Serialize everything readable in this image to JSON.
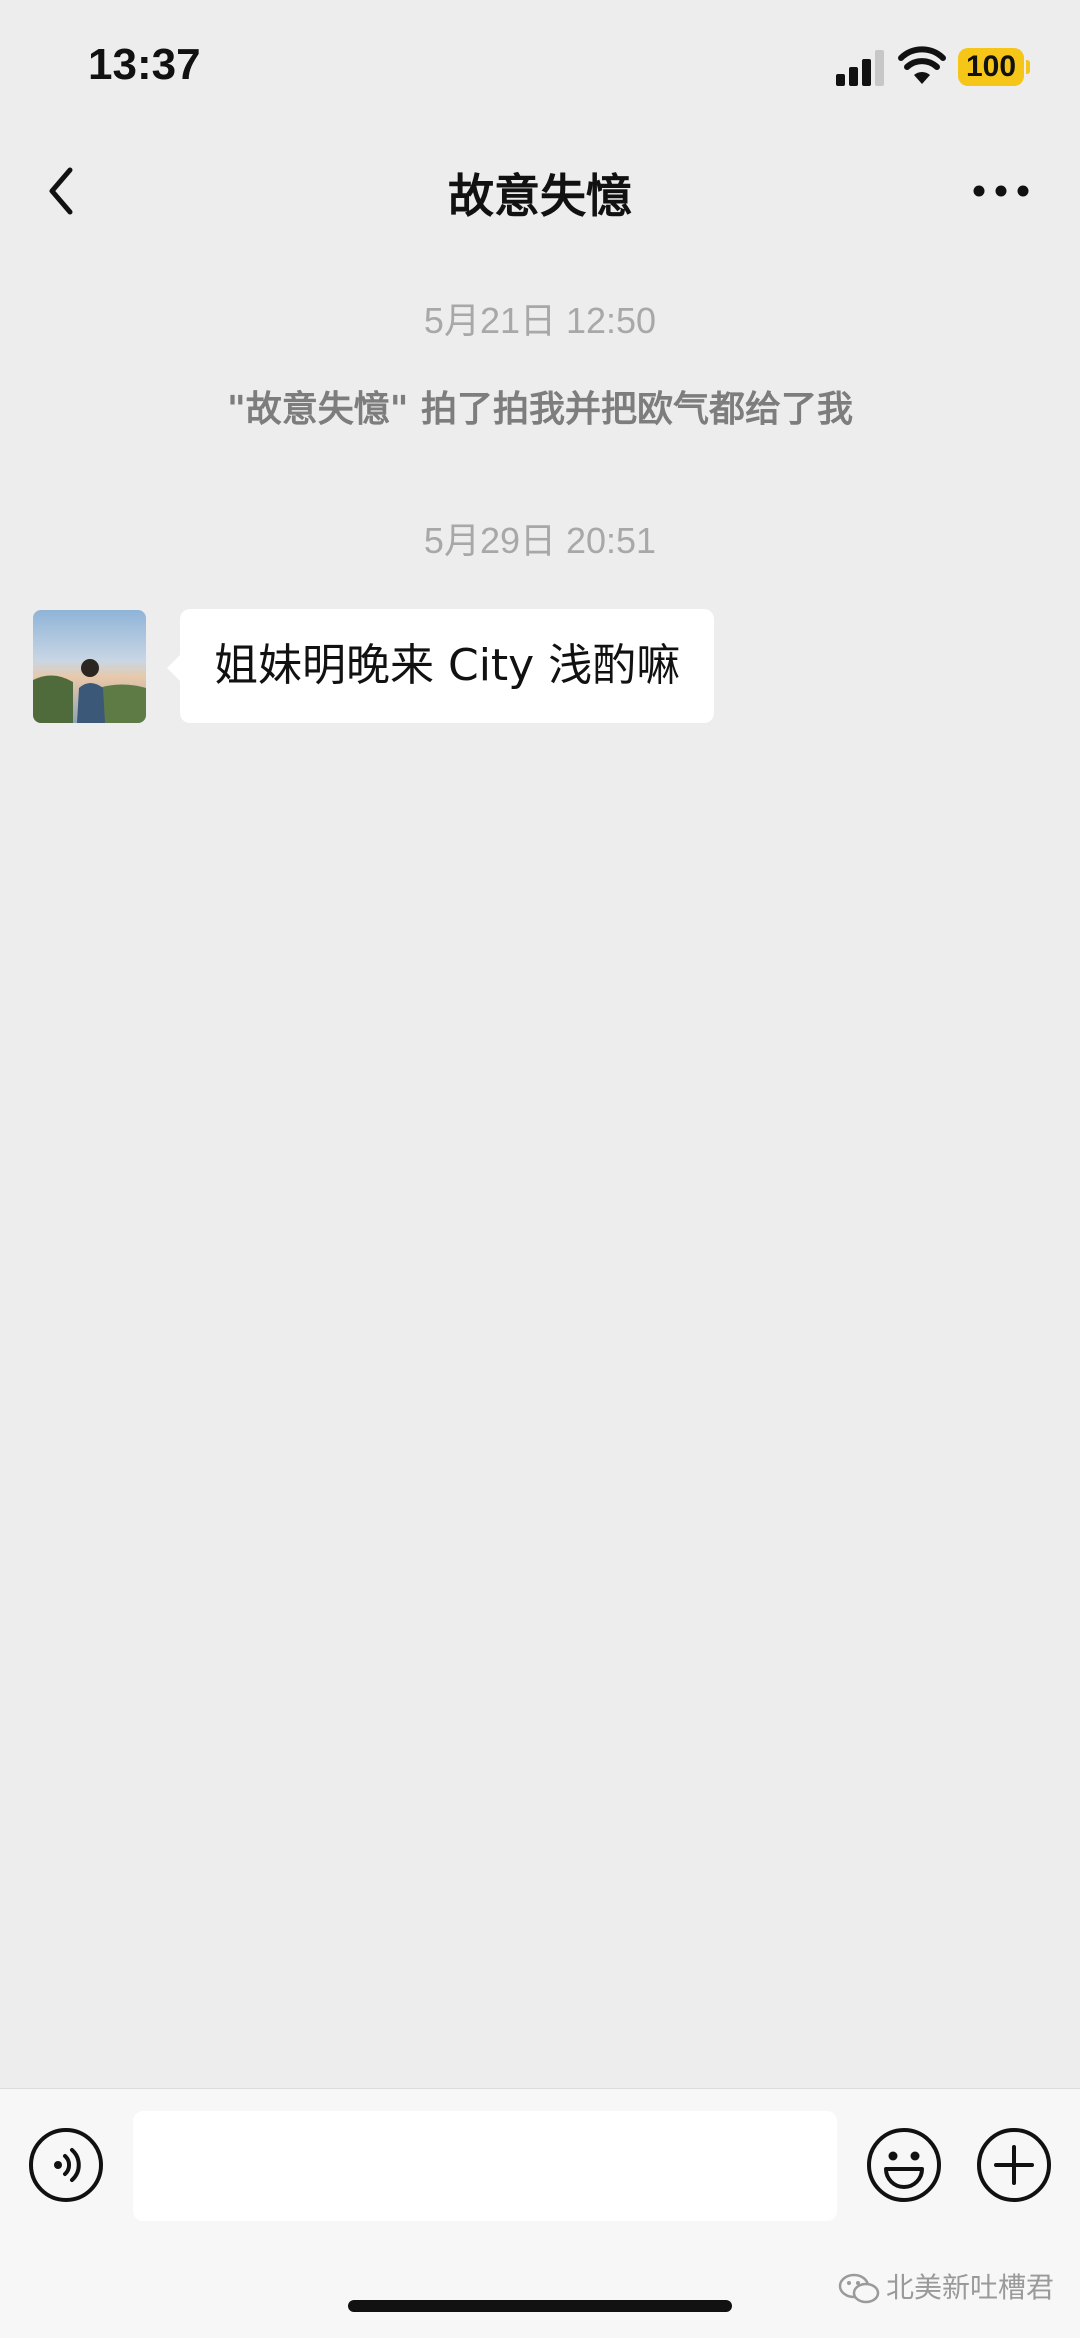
{
  "status_bar": {
    "time": "13:37",
    "battery": "100",
    "battery_color": "#f5c518"
  },
  "nav": {
    "title": "故意失憶",
    "back_icon": "chevron-left-icon",
    "more_icon": "ellipsis-icon"
  },
  "chat": {
    "timestamp_1": "5月21日 12:50",
    "system_message": "\"故意失憶\" 拍了拍我并把欧气都给了我",
    "timestamp_2": "5月29日 20:51",
    "message_text": "姐妹明晚来 City 浅酌嘛"
  },
  "input_bar": {
    "voice_icon": "voice-icon",
    "emoji_icon": "emoji-icon",
    "plus_icon": "plus-icon"
  },
  "watermark": "北美新吐槽君",
  "colors": {
    "background": "#ededed",
    "bubble": "#ffffff",
    "input_bar": "#f7f7f7"
  }
}
